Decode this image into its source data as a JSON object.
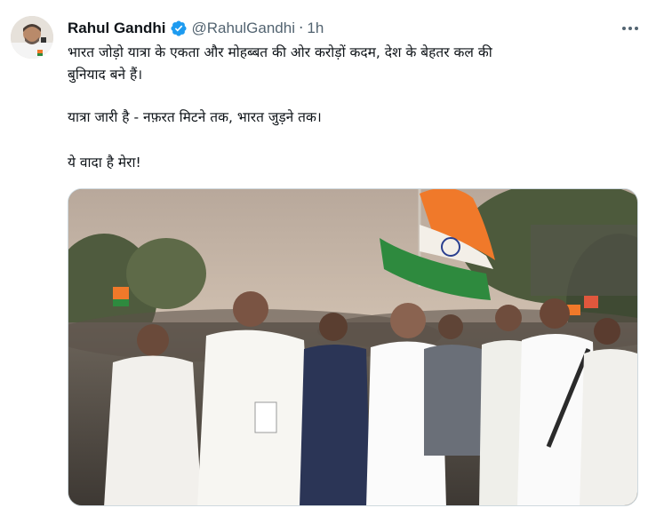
{
  "tweet": {
    "author": {
      "display_name": "Rahul Gandhi",
      "handle": "@RahulGandhi",
      "verified": true,
      "avatar_icon": "profile-photo"
    },
    "separator": "·",
    "timestamp": "1h",
    "more_icon": "more-horizontal-icon",
    "text_lines": [
      "भारत जोड़ो यात्रा के एकता और मोहब्बत की ओर करोड़ों कदम, देश के बेहतर कल की",
      "बुनियाद बने हैं।",
      "यात्रा जारी है - नफ़रत मिटने तक, भारत जुड़ने तक।",
      "ये वादा है मेरा!"
    ],
    "media": {
      "type": "photo"
    }
  },
  "colors": {
    "text_primary": "#0f1419",
    "text_secondary": "#536471",
    "verified_blue": "#1d9bf0",
    "flag_saffron": "#f0792a",
    "flag_green": "#2e8a3e"
  }
}
